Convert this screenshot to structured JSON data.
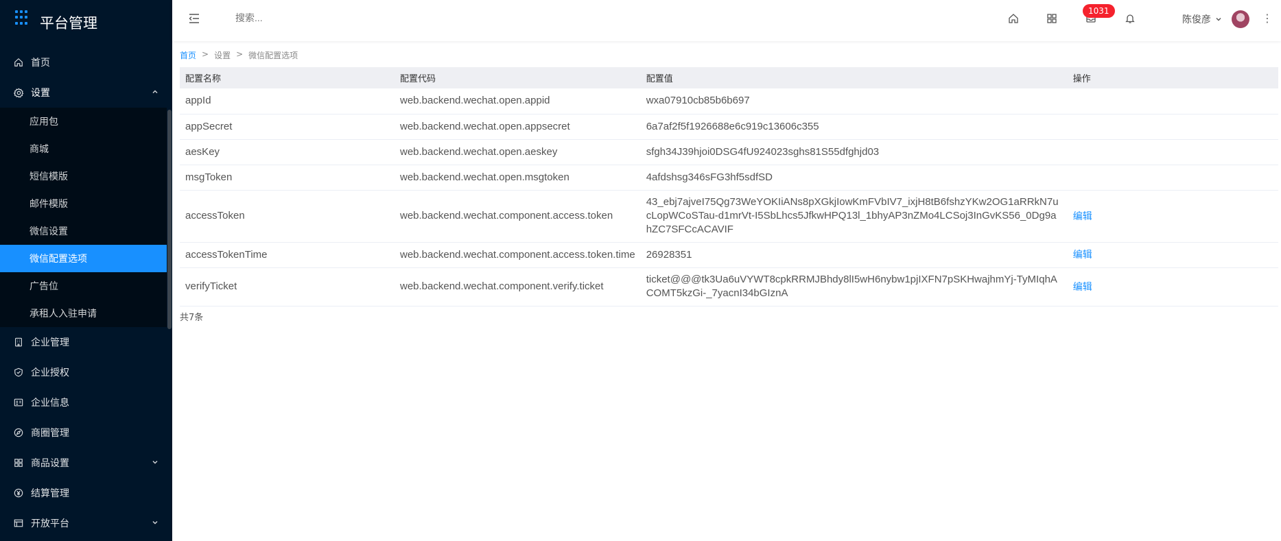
{
  "brand": {
    "title": "平台管理"
  },
  "sidebar": {
    "items": [
      {
        "label": "首页",
        "icon": "home-icon"
      },
      {
        "label": "设置",
        "icon": "gear-icon",
        "open": true,
        "children": [
          {
            "label": "应用包"
          },
          {
            "label": "商城"
          },
          {
            "label": "短信模版"
          },
          {
            "label": "邮件模版"
          },
          {
            "label": "微信设置"
          },
          {
            "label": "微信配置选项",
            "active": true
          },
          {
            "label": "广告位"
          },
          {
            "label": "承租人入驻申请"
          }
        ]
      },
      {
        "label": "企业管理",
        "icon": "enterprise-icon"
      },
      {
        "label": "企业授权",
        "icon": "shield-icon"
      },
      {
        "label": "企业信息",
        "icon": "id-card-icon"
      },
      {
        "label": "商圈管理",
        "icon": "compass-icon"
      },
      {
        "label": "商品设置",
        "icon": "apps-icon",
        "expandable": true
      },
      {
        "label": "结算管理",
        "icon": "yen-icon"
      },
      {
        "label": "开放平台",
        "icon": "table-icon",
        "expandable": true
      }
    ]
  },
  "header": {
    "search_placeholder": "搜索...",
    "badge_count": "1031",
    "user_name": "陈俊彦"
  },
  "breadcrumb": {
    "home": "首页",
    "sep": ">",
    "level1": "设置",
    "level2": "微信配置选项"
  },
  "table": {
    "columns": [
      "配置名称",
      "配置代码",
      "配置值",
      "操作"
    ],
    "edit_label": "编辑",
    "rows": [
      {
        "name": "appId",
        "code": "web.backend.wechat.open.appid",
        "value": "wxa07910cb85b6b697",
        "editable": false
      },
      {
        "name": "appSecret",
        "code": "web.backend.wechat.open.appsecret",
        "value": "6a7af2f5f1926688e6c919c13606c355",
        "editable": false
      },
      {
        "name": "aesKey",
        "code": "web.backend.wechat.open.aeskey",
        "value": "sfgh34J39hjoi0DSG4fU924023sghs81S55dfghjd03",
        "editable": false
      },
      {
        "name": "msgToken",
        "code": "web.backend.wechat.open.msgtoken",
        "value": "4afdshsg346sFG3hf5sdfSD",
        "editable": false
      },
      {
        "name": "accessToken",
        "code": "web.backend.wechat.component.access.token",
        "value": "43_ebj7ajveI75Qg73WeYOKIiANs8pXGkjIowKmFVbIV7_ixjH8tB6fshzYKw2OG1aRRkN7ucLopWCoSTau-d1mrVt-I5SbLhcs5JfkwHPQ13l_1bhyAP3nZMo4LCSoj3InGvKS56_0Dg9ahZC7SFCcACAVIF",
        "editable": true
      },
      {
        "name": "accessTokenTime",
        "code": "web.backend.wechat.component.access.token.time",
        "value": "26928351",
        "editable": true
      },
      {
        "name": "verifyTicket",
        "code": "web.backend.wechat.component.verify.ticket",
        "value": "ticket@@@tk3Ua6uVYWT8cpkRRMJBhdy8lI5wH6nybw1pjIXFN7pSKHwajhmYj-TyMIqhACOMT5kzGi-_7yacnI34bGIznA",
        "editable": true
      }
    ],
    "total_text": "共7条"
  },
  "colors": {
    "sidebar_bg": "#001529",
    "accent": "#1890ff",
    "badge": "#f5222d"
  }
}
